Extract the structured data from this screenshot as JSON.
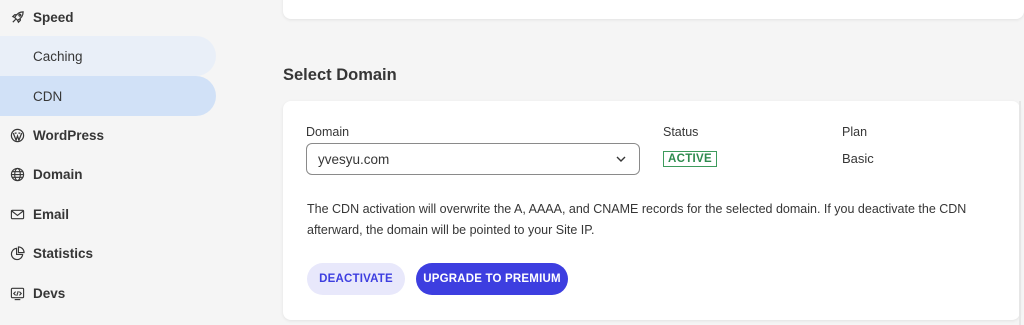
{
  "sidebar": {
    "items": [
      {
        "label": "Speed",
        "icon": "rocket-icon"
      },
      {
        "label": "WordPress",
        "icon": "wordpress-icon"
      },
      {
        "label": "Domain",
        "icon": "globe-icon"
      },
      {
        "label": "Email",
        "icon": "envelope-icon"
      },
      {
        "label": "Statistics",
        "icon": "pie-chart-icon"
      },
      {
        "label": "Devs",
        "icon": "code-icon"
      }
    ],
    "sub_items": [
      {
        "label": "Caching"
      },
      {
        "label": "CDN",
        "active": true
      }
    ]
  },
  "main": {
    "section_title": "Select Domain",
    "domain_label": "Domain",
    "domain_value": "yvesyu.com",
    "status_label": "Status",
    "status_value": "ACTIVE",
    "plan_label": "Plan",
    "plan_value": "Basic",
    "description": "The CDN activation will overwrite the A, AAAA, and CNAME records for the selected domain. If you deactivate the CDN afterward, the domain will be pointed to your Site IP.",
    "deactivate_label": "DEACTIVATE",
    "upgrade_label": "UPGRADE TO PREMIUM"
  },
  "colors": {
    "accent": "#3d3ee0",
    "active_nav": "#d1e1f7",
    "status_active": "#2e8b4e"
  }
}
